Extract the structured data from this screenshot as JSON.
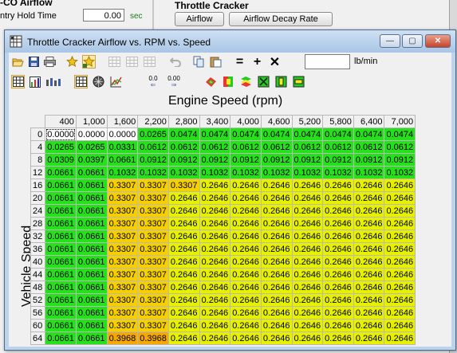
{
  "background": {
    "left_title": "-CO Airflow",
    "hold_label": "ntry Hold Time",
    "hold_value": "0.00",
    "hold_unit": "sec",
    "right_title": "Throttle Cracker",
    "buttons": [
      "Airflow",
      "Airflow Decay Rate"
    ]
  },
  "window": {
    "title": "Throttle Cracker Airflow vs. RPM vs. Speed",
    "controls": {
      "minimize": "—",
      "maximize": "▢",
      "close": "✕"
    }
  },
  "toolbar": {
    "units_value": "",
    "units_label": "lb/min",
    "icons_row1": [
      "open-icon",
      "save-icon",
      "print-icon",
      "star-icon",
      "star-pressed-icon",
      "grid-a-icon",
      "grid-b-icon",
      "grid-c-icon",
      "undo-icon",
      "copy-icon",
      "paste-icon",
      "equals-icon",
      "plus-icon",
      "multiply-icon"
    ],
    "icons_row2": [
      "table-view-icon",
      "chart-view-icon",
      "bars-icon",
      "table-view-active-icon",
      "3d-icon",
      "scatter-icon",
      "decimal-less-icon",
      "decimal-more-icon",
      "color-a-icon",
      "color-b-icon",
      "color-c-icon",
      "color-d-icon",
      "color-e-icon",
      "color-f-icon"
    ],
    "decimal_less_label": "0.0",
    "decimal_more_label": "0.00"
  },
  "axes": {
    "x_title": "Engine Speed (rpm)",
    "y_title": "Vehicle Speed (mph)"
  },
  "table": {
    "columns": [
      "400",
      "1,000",
      "1,600",
      "2,200",
      "2,800",
      "3,400",
      "4,000",
      "4,600",
      "5,200",
      "5,800",
      "6,400",
      "7,000"
    ],
    "rows": [
      {
        "label": "0",
        "values": [
          "0.0000",
          "0.0000",
          "0.0000",
          "0.0265",
          "0.0474",
          "0.0474",
          "0.0474",
          "0.0474",
          "0.0474",
          "0.0474",
          "0.0474",
          "0.0474"
        ]
      },
      {
        "label": "4",
        "values": [
          "0.0265",
          "0.0265",
          "0.0331",
          "0.0612",
          "0.0612",
          "0.0612",
          "0.0612",
          "0.0612",
          "0.0612",
          "0.0612",
          "0.0612",
          "0.0612"
        ]
      },
      {
        "label": "8",
        "values": [
          "0.0309",
          "0.0397",
          "0.0661",
          "0.0912",
          "0.0912",
          "0.0912",
          "0.0912",
          "0.0912",
          "0.0912",
          "0.0912",
          "0.0912",
          "0.0912"
        ]
      },
      {
        "label": "12",
        "values": [
          "0.0661",
          "0.0661",
          "0.1032",
          "0.1032",
          "0.1032",
          "0.1032",
          "0.1032",
          "0.1032",
          "0.1032",
          "0.1032",
          "0.1032",
          "0.1032"
        ]
      },
      {
        "label": "16",
        "values": [
          "0.0661",
          "0.0661",
          "0.3307",
          "0.3307",
          "0.3307",
          "0.2646",
          "0.2646",
          "0.2646",
          "0.2646",
          "0.2646",
          "0.2646",
          "0.2646"
        ]
      },
      {
        "label": "20",
        "values": [
          "0.0661",
          "0.0661",
          "0.3307",
          "0.3307",
          "0.2646",
          "0.2646",
          "0.2646",
          "0.2646",
          "0.2646",
          "0.2646",
          "0.2646",
          "0.2646"
        ]
      },
      {
        "label": "24",
        "values": [
          "0.0661",
          "0.0661",
          "0.3307",
          "0.3307",
          "0.2646",
          "0.2646",
          "0.2646",
          "0.2646",
          "0.2646",
          "0.2646",
          "0.2646",
          "0.2646"
        ]
      },
      {
        "label": "28",
        "values": [
          "0.0661",
          "0.0661",
          "0.3307",
          "0.3307",
          "0.2646",
          "0.2646",
          "0.2646",
          "0.2646",
          "0.2646",
          "0.2646",
          "0.2646",
          "0.2646"
        ]
      },
      {
        "label": "32",
        "values": [
          "0.0661",
          "0.0661",
          "0.3307",
          "0.3307",
          "0.2646",
          "0.2646",
          "0.2646",
          "0.2646",
          "0.2646",
          "0.2646",
          "0.2646",
          "0.2646"
        ]
      },
      {
        "label": "36",
        "values": [
          "0.0661",
          "0.0661",
          "0.3307",
          "0.3307",
          "0.2646",
          "0.2646",
          "0.2646",
          "0.2646",
          "0.2646",
          "0.2646",
          "0.2646",
          "0.2646"
        ]
      },
      {
        "label": "40",
        "values": [
          "0.0661",
          "0.0661",
          "0.3307",
          "0.3307",
          "0.2646",
          "0.2646",
          "0.2646",
          "0.2646",
          "0.2646",
          "0.2646",
          "0.2646",
          "0.2646"
        ]
      },
      {
        "label": "44",
        "values": [
          "0.0661",
          "0.0661",
          "0.3307",
          "0.3307",
          "0.2646",
          "0.2646",
          "0.2646",
          "0.2646",
          "0.2646",
          "0.2646",
          "0.2646",
          "0.2646"
        ]
      },
      {
        "label": "48",
        "values": [
          "0.0661",
          "0.0661",
          "0.3307",
          "0.3307",
          "0.2646",
          "0.2646",
          "0.2646",
          "0.2646",
          "0.2646",
          "0.2646",
          "0.2646",
          "0.2646"
        ]
      },
      {
        "label": "52",
        "values": [
          "0.0661",
          "0.0661",
          "0.3307",
          "0.3307",
          "0.2646",
          "0.2646",
          "0.2646",
          "0.2646",
          "0.2646",
          "0.2646",
          "0.2646",
          "0.2646"
        ]
      },
      {
        "label": "56",
        "values": [
          "0.0661",
          "0.0661",
          "0.3307",
          "0.3307",
          "0.2646",
          "0.2646",
          "0.2646",
          "0.2646",
          "0.2646",
          "0.2646",
          "0.2646",
          "0.2646"
        ]
      },
      {
        "label": "60",
        "values": [
          "0.0661",
          "0.0661",
          "0.3307",
          "0.3307",
          "0.2646",
          "0.2646",
          "0.2646",
          "0.2646",
          "0.2646",
          "0.2646",
          "0.2646",
          "0.2646"
        ]
      },
      {
        "label": "64",
        "values": [
          "0.0661",
          "0.0661",
          "0.3968",
          "0.3968",
          "0.2646",
          "0.2646",
          "0.2646",
          "0.2646",
          "0.2646",
          "0.2646",
          "0.2646",
          "0.2646"
        ]
      }
    ]
  },
  "colors": {
    "low": "#26e01c",
    "mid": "#e6f000",
    "high": "#f5a800",
    "zero": "#ffffff",
    "window_frame": "#bcd3ec"
  }
}
